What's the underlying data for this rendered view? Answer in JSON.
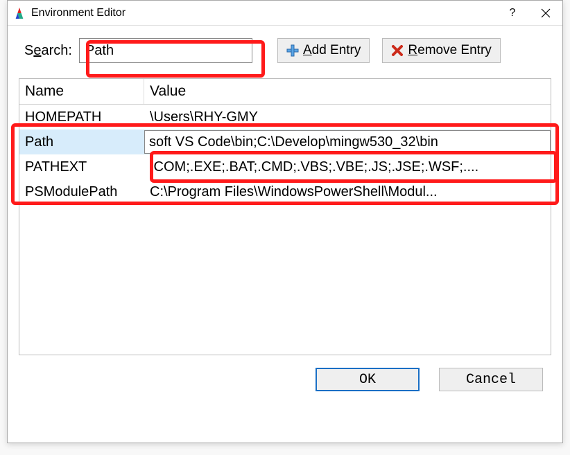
{
  "window": {
    "title": "Environment Editor"
  },
  "search": {
    "label_pre": "S",
    "label_ul": "e",
    "label_post": "arch:",
    "value": "Path"
  },
  "buttons": {
    "add_ul": "A",
    "add_rest": "dd Entry",
    "remove_ul": "R",
    "remove_rest": "emove Entry",
    "ok": "OK",
    "cancel": "Cancel"
  },
  "table": {
    "headers": {
      "name": "Name",
      "value": "Value"
    },
    "rows": [
      {
        "name": "HOMEPATH",
        "value": "\\Users\\RHY-GMY",
        "selected": false
      },
      {
        "name": "Path",
        "value": "soft VS Code\\bin;C:\\Develop\\mingw530_32\\bin",
        "selected": true
      },
      {
        "name": "PATHEXT",
        "value": ".COM;.EXE;.BAT;.CMD;.VBS;.VBE;.JS;.JSE;.WSF;....",
        "selected": false
      },
      {
        "name": "PSModulePath",
        "value": "C:\\Program Files\\WindowsPowerShell\\Modul...",
        "selected": false
      }
    ]
  }
}
